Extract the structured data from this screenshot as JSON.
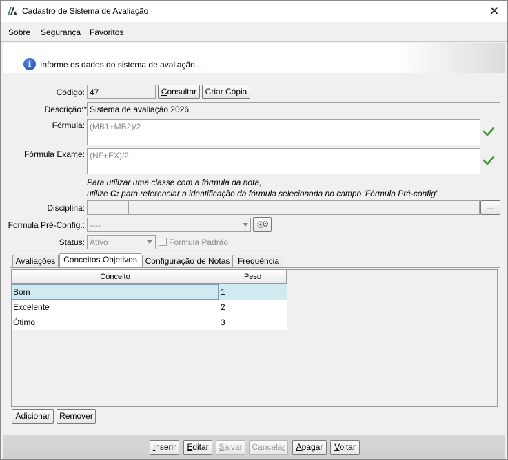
{
  "window": {
    "title": "Cadastro de Sistema de Avaliação"
  },
  "menu": {
    "items": [
      "Sobre",
      "Segurança",
      "Favoritos"
    ]
  },
  "banner": {
    "message": "Informe os dados do sistema de avaliação..."
  },
  "form": {
    "codigo": {
      "label": "Código:",
      "value": "47"
    },
    "consultar_label": "Consultar",
    "criar_copia_label": "Criar Cópia",
    "descricao": {
      "label": "Descrição:*",
      "value": "Sistema de avaliação 2026"
    },
    "formula": {
      "label": "Fórmula:",
      "value": "(MB1+MB2)/2"
    },
    "formula_exame": {
      "label": "Fórmula Exame:",
      "value": "(NF+EX)/2"
    },
    "hint_line1": "Para utilizar uma classe com a fórmula da nota,",
    "hint_line2_prefix": "utilize ",
    "hint_line2_bold": "C:",
    "hint_line2_suffix": " para referenciar a identificação da fórmula selecionada no campo 'Fórmula Pré-config'.",
    "disciplina": {
      "label": "Disciplina:",
      "code": "",
      "name": "",
      "browse_label": "..."
    },
    "formula_pre_config": {
      "label": "Formula Pré-Config.:",
      "value": "----"
    },
    "status": {
      "label": "Status:",
      "value": "Ativo"
    },
    "formula_padrao_label": "Formula Padrão"
  },
  "tabs": [
    "Avaliações",
    "Conceitos Objetivos",
    "Configuração de Notas",
    "Frequência"
  ],
  "active_tab": "Conceitos Objetivos",
  "grid": {
    "columns": [
      "Conceito",
      "Peso"
    ],
    "rows": [
      {
        "conceito": "Bom",
        "peso": "1"
      },
      {
        "conceito": "Excelente",
        "peso": "2"
      },
      {
        "conceito": "Ótimo",
        "peso": "3"
      }
    ]
  },
  "grid_buttons": {
    "adicionar": "Adicionar",
    "remover": "Remover"
  },
  "actions": {
    "inserir": "Inserir",
    "editar": "Editar",
    "salvar": "Salvar",
    "cancelar": "Cancelar",
    "apagar": "Apagar",
    "voltar": "Voltar"
  },
  "colors": {
    "valid_check": "#3a9a2a",
    "selected_row": "#cfeaf0",
    "info_icon": "#1a47a8"
  }
}
